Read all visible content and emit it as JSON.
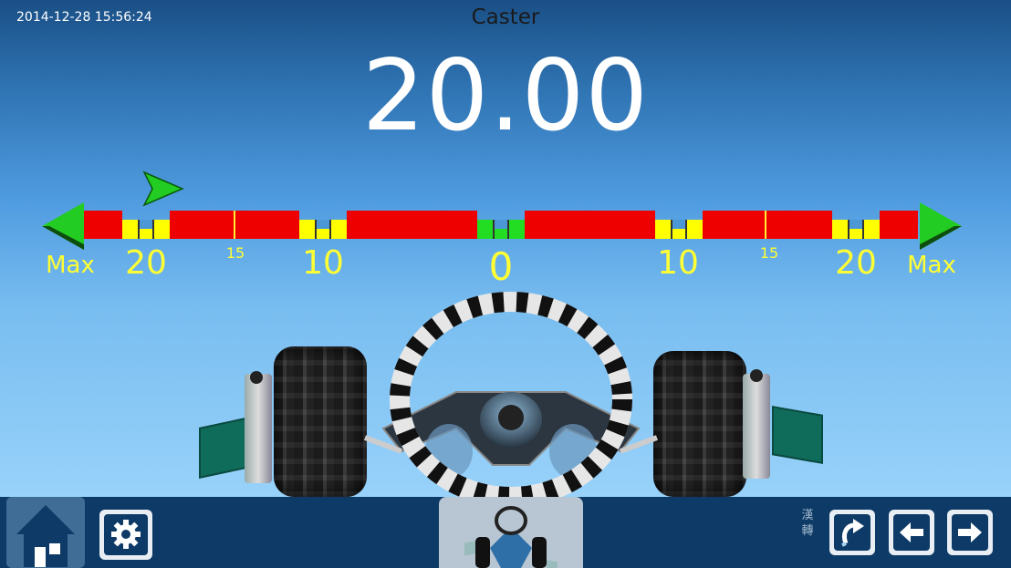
{
  "header": {
    "datetime": "2014-12-28 15:56:24",
    "title": "Caster",
    "reading": "20.00"
  },
  "scale": {
    "left_labels": [
      "Max",
      "20",
      "15",
      "10"
    ],
    "center_label": "0",
    "right_labels": [
      "10",
      "15",
      "20",
      "Max"
    ],
    "pointer_value": 20,
    "pointer_side": "left",
    "colors": {
      "out_of_range": "#ee0000",
      "tolerance_mark": "#ffff00",
      "center_mark": "#22dd22",
      "arrow": "#22cc22",
      "label": "#ffff33"
    }
  },
  "bottombar": {
    "home_icon": "home-icon",
    "settings_icon": "gear-icon",
    "car_view_icon": "car-thumbnail-icon",
    "language_label": "漢\n轉",
    "refresh_icon": "refresh-icon",
    "prev_icon": "arrow-left-icon",
    "next_icon": "arrow-right-icon"
  }
}
